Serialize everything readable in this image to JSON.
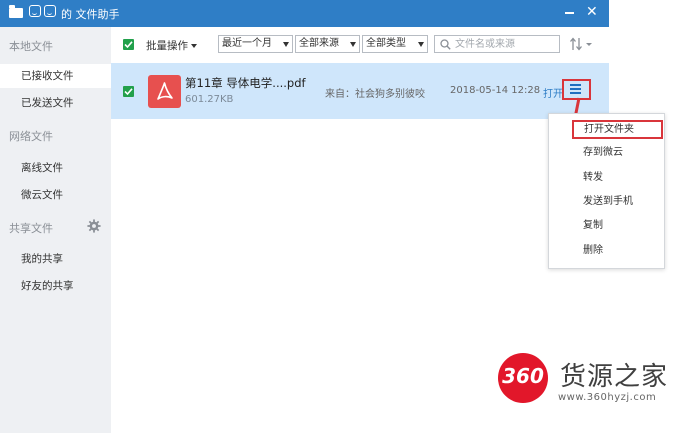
{
  "window": {
    "title": "的 文件助手"
  },
  "sidebar": {
    "groups": [
      {
        "label": "本地文件",
        "items": [
          "已接收文件",
          "已发送文件"
        ]
      },
      {
        "label": "网络文件",
        "items": [
          "离线文件",
          "微云文件"
        ]
      },
      {
        "label": "共享文件",
        "items": [
          "我的共享",
          "好友的共享"
        ]
      }
    ],
    "active_item": "已接收文件"
  },
  "toolbar": {
    "batch_label": "批量操作",
    "time_filter": "最近一个月",
    "source_filter": "全部来源",
    "type_filter": "全部类型",
    "search_placeholder": "文件名或来源"
  },
  "files": [
    {
      "name": "第11章 导体电学....pdf",
      "size": "601.27KB",
      "from": "来自：社会狗多别彼咬",
      "time": "2018-05-14 12:28",
      "open_label": "打开"
    }
  ],
  "context_menu": {
    "items": [
      "打开文件夹",
      "存到微云",
      "转发",
      "发送到手机",
      "复制",
      "删除"
    ],
    "highlighted": "打开文件夹"
  },
  "watermark": {
    "logo_text": "360",
    "title": "货源之家",
    "url": "www.360hyzj.com"
  },
  "colors": {
    "titlebar": "#2f7ec6",
    "selected_row": "#cfe6fb",
    "checkbox": "#22a04b",
    "pdf_icon": "#e7504f",
    "highlight_border": "#d9353b",
    "watermark_red": "#e2172a"
  },
  "icons": [
    "folder-icon",
    "emoji-icon",
    "minimize-icon",
    "close-icon",
    "checkbox-icon",
    "search-icon",
    "sort-icon",
    "pdf-icon",
    "menu-icon",
    "gear-icon"
  ]
}
